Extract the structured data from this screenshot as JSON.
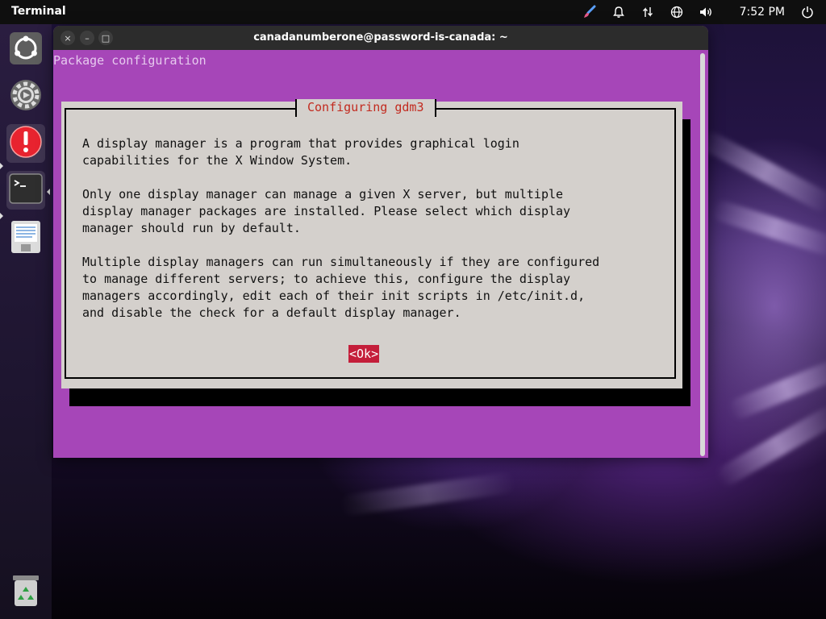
{
  "topbar": {
    "app_name": "Terminal",
    "clock": "7:52 PM",
    "tray_icons": [
      "paintbrush-icon",
      "bell-icon",
      "network-transfer-icon",
      "globe-icon",
      "volume-icon",
      "power-icon"
    ]
  },
  "dock": {
    "items": [
      {
        "name": "ubuntu-installer",
        "icon": "ubuntu-logo-icon"
      },
      {
        "name": "settings",
        "icon": "gear-icon"
      },
      {
        "name": "software-updater",
        "icon": "exclamation-icon",
        "active": true
      },
      {
        "name": "terminal",
        "icon": "terminal-icon",
        "active": true
      },
      {
        "name": "text-editor",
        "icon": "notepad-icon"
      },
      {
        "name": "trash",
        "icon": "recycle-bin-icon"
      }
    ]
  },
  "window": {
    "title": "canadanumberone@password-is-canada: ~",
    "buttons": {
      "close": "×",
      "minimize": "–",
      "maximize": "□"
    }
  },
  "terminal": {
    "header": "Package configuration",
    "dialog": {
      "title": "Configuring gdm3",
      "paragraphs": [
        "A display manager is a program that provides graphical login\ncapabilities for the X Window System.",
        "Only one display manager can manage a given X server, but multiple\ndisplay manager packages are installed. Please select which display\nmanager should run by default.",
        "Multiple display managers can run simultaneously if they are configured\nto manage different servers; to achieve this, configure the display\nmanagers accordingly, edit each of their init scripts in /etc/init.d,\nand disable the check for a default display manager."
      ],
      "ok_label": "<Ok>"
    }
  },
  "colors": {
    "terminal_bg": "#a646b8",
    "dialog_bg": "#d4d0cc",
    "dialog_title": "#c22a1f",
    "ok_bg": "#c41e3a"
  }
}
